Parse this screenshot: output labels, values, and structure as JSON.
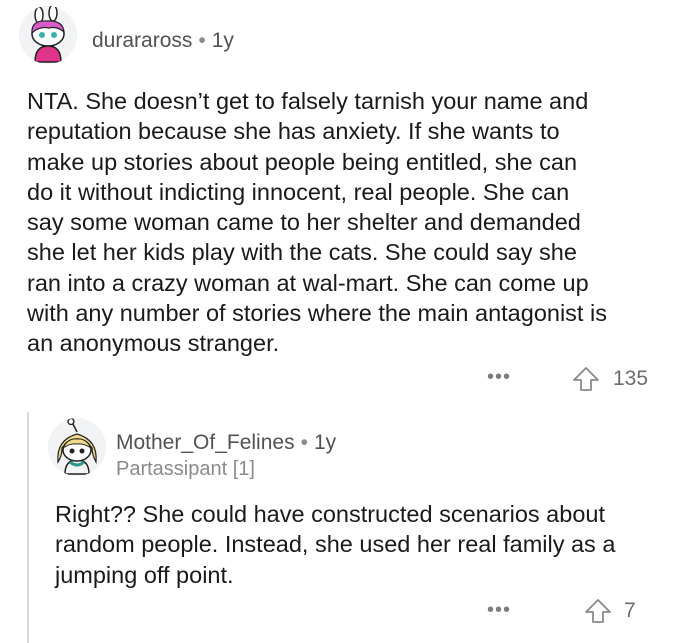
{
  "comments": [
    {
      "username": "duraraross",
      "separator": "•",
      "age": "1y",
      "body_lines": [
        "NTA. She doesn’t get to falsely tarnish your name and",
        "reputation because she has anxiety. If she wants to",
        "make up stories about people being entitled, she can",
        "do it without indicting innocent, real people. She can",
        "say some woman came to her shelter and demanded",
        "she let her kids play with the cats. She could say she",
        "ran into a crazy woman at wal-mart. She can come up",
        "with any number of stories where the main antagonist is",
        "an anonymous stranger."
      ],
      "more": "•••",
      "votes": "135"
    },
    {
      "username": "Mother_Of_Felines",
      "separator": "•",
      "age": "1y",
      "flair": "Partassipant [1]",
      "body_lines": [
        "Right?? She could have constructed scenarios about",
        "random people. Instead, she used her real family as a",
        "jumping off point."
      ],
      "more": "•••",
      "votes": "7"
    }
  ],
  "icons": {
    "avatar_1": "snoo-avatar-pink-hair",
    "avatar_2": "snoo-avatar-blonde-hair",
    "more": "more-options-icon",
    "upvote": "upvote-arrow-icon"
  },
  "colors": {
    "text": "#1a1a1b",
    "meta": "#8a8a8a",
    "thread_line": "#dadada"
  }
}
